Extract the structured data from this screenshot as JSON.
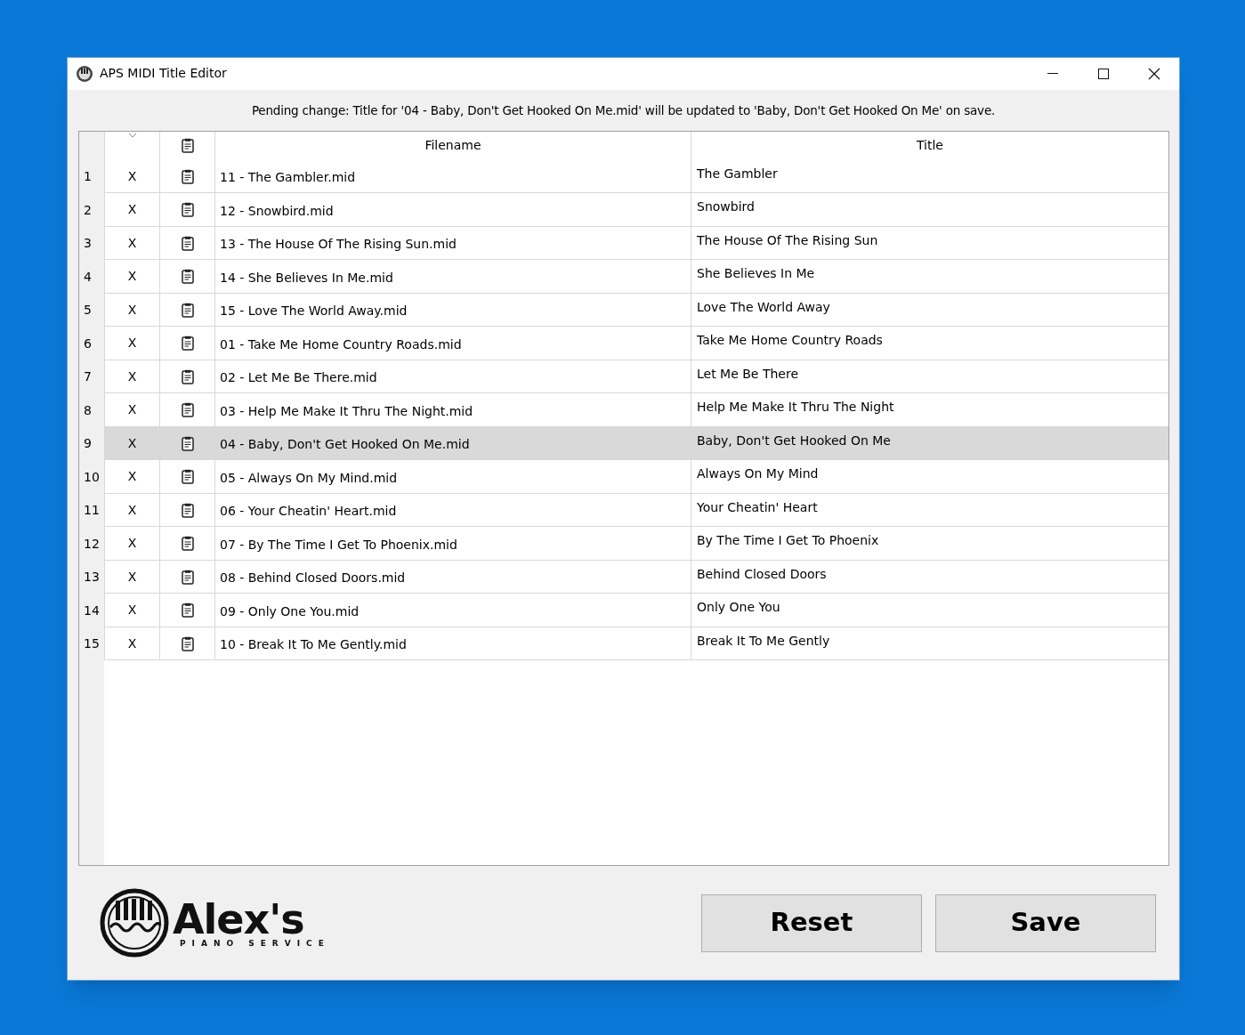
{
  "window": {
    "title": "APS MIDI Title Editor"
  },
  "message": "Pending change: Title for '04 - Baby, Don't Get Hooked On Me.mid' will be updated to 'Baby, Don't Get Hooked On Me' on save.",
  "table": {
    "columns": [
      "Filename",
      "Title"
    ],
    "rows": [
      {
        "number": "1",
        "remove": "X",
        "filename": "11 - The Gambler.mid",
        "title": "The Gambler",
        "selected": false
      },
      {
        "number": "2",
        "remove": "X",
        "filename": "12 - Snowbird.mid",
        "title": "Snowbird",
        "selected": false
      },
      {
        "number": "3",
        "remove": "X",
        "filename": "13 - The House Of The Rising Sun.mid",
        "title": "The House Of The Rising Sun",
        "selected": false
      },
      {
        "number": "4",
        "remove": "X",
        "filename": "14 - She Believes In Me.mid",
        "title": "She Believes In Me",
        "selected": false
      },
      {
        "number": "5",
        "remove": "X",
        "filename": "15 - Love The World Away.mid",
        "title": "Love The World Away",
        "selected": false
      },
      {
        "number": "6",
        "remove": "X",
        "filename": "01 - Take Me Home Country Roads.mid",
        "title": "Take Me Home Country Roads",
        "selected": false
      },
      {
        "number": "7",
        "remove": "X",
        "filename": "02 - Let Me Be There.mid",
        "title": "Let Me Be There",
        "selected": false
      },
      {
        "number": "8",
        "remove": "X",
        "filename": "03 - Help Me Make It Thru The Night.mid",
        "title": "Help Me Make It Thru The Night",
        "selected": false
      },
      {
        "number": "9",
        "remove": "X",
        "filename": "04 - Baby, Don't Get Hooked On Me.mid",
        "title": "Baby, Don't Get Hooked On Me",
        "selected": true
      },
      {
        "number": "10",
        "remove": "X",
        "filename": "05 - Always On My Mind.mid",
        "title": "Always On My Mind",
        "selected": false
      },
      {
        "number": "11",
        "remove": "X",
        "filename": "06 - Your Cheatin' Heart.mid",
        "title": "Your Cheatin' Heart",
        "selected": false
      },
      {
        "number": "12",
        "remove": "X",
        "filename": "07 - By The Time I Get To Phoenix.mid",
        "title": "By The Time I Get To Phoenix",
        "selected": false
      },
      {
        "number": "13",
        "remove": "X",
        "filename": "08 - Behind Closed Doors.mid",
        "title": "Behind Closed Doors",
        "selected": false
      },
      {
        "number": "14",
        "remove": "X",
        "filename": "09 - Only One You.mid",
        "title": "Only One You",
        "selected": false
      },
      {
        "number": "15",
        "remove": "X",
        "filename": "10 - Break It To Me Gently.mid",
        "title": "Break It To Me Gently",
        "selected": false
      }
    ]
  },
  "logo": {
    "name": "Alex's",
    "tagline": "PIANO SERVICE"
  },
  "buttons": [
    "Reset",
    "Save"
  ]
}
